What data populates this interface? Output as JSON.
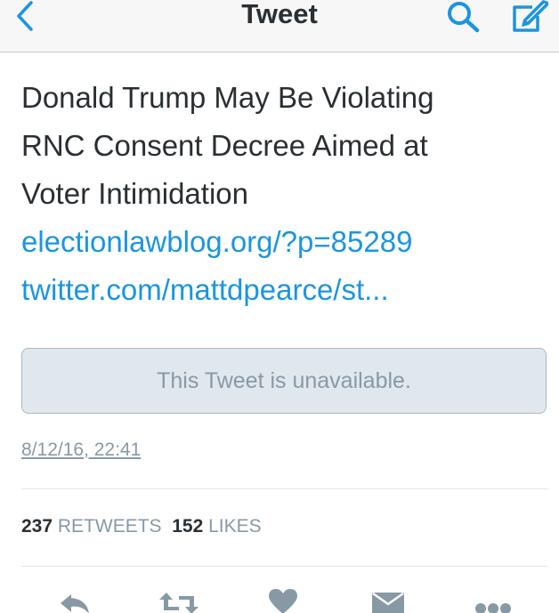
{
  "navbar": {
    "title": "Tweet",
    "back_icon": "chevron-left-icon",
    "search_icon": "search-icon",
    "compose_icon": "compose-icon",
    "accent_color": "#1b95e0"
  },
  "tweet": {
    "lines": [
      "Donald Trump May Be Violating",
      "RNC Consent Decree Aimed at",
      "Voter Intimidation"
    ],
    "links": [
      "electionlawblog.org/?p=85289",
      "twitter.com/mattdpearce/st..."
    ],
    "quoted_tweet_message": "This Tweet is unavailable.",
    "timestamp": "8/12/16, 22:41"
  },
  "stats": {
    "retweets_count": "237",
    "retweets_label": "RETWEETS",
    "likes_count": "152",
    "likes_label": "LIKES"
  },
  "actions": [
    {
      "icon": "reply-icon"
    },
    {
      "icon": "retweet-icon"
    },
    {
      "icon": "heart-icon"
    },
    {
      "icon": "envelope-icon"
    },
    {
      "icon": "more-icon"
    }
  ]
}
